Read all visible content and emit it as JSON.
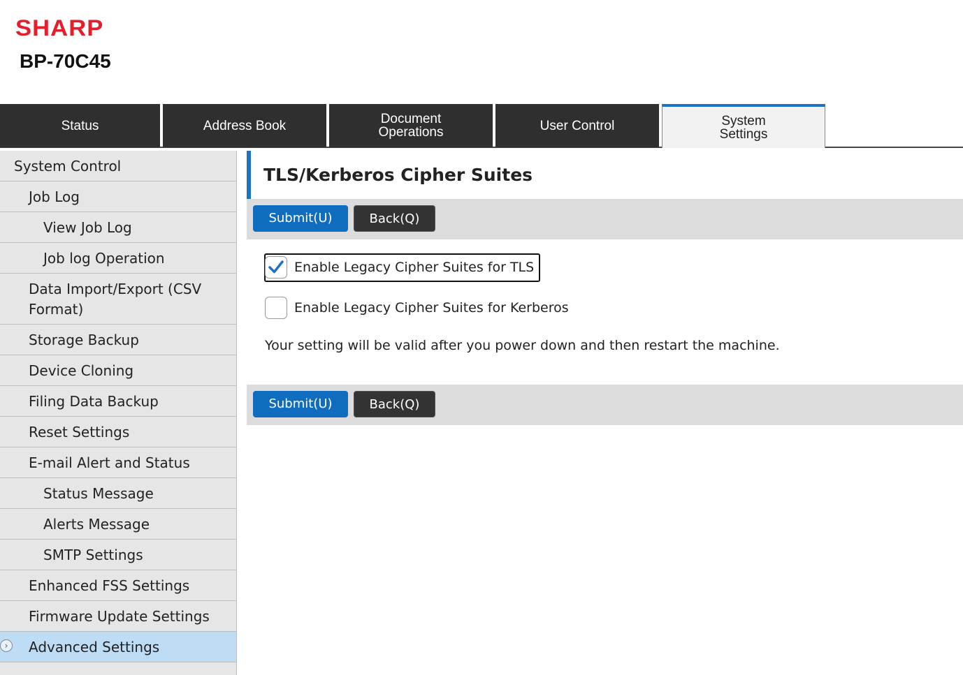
{
  "header": {
    "brand": "SHARP",
    "model": "BP-70C45"
  },
  "tabs": [
    {
      "label": "Status",
      "active": false
    },
    {
      "label": "Address Book",
      "active": false
    },
    {
      "label": "Document\nOperations",
      "active": false
    },
    {
      "label": "User Control",
      "active": false
    },
    {
      "label": "System\nSettings",
      "active": true
    }
  ],
  "sidebar": {
    "items": [
      {
        "label": "System Control",
        "level": 0
      },
      {
        "label": "Job Log",
        "level": 1
      },
      {
        "label": "View Job Log",
        "level": 2
      },
      {
        "label": "Job log Operation",
        "level": 2
      },
      {
        "label": "Data Import/Export (CSV Format)",
        "level": 1
      },
      {
        "label": "Storage Backup",
        "level": 1
      },
      {
        "label": "Device Cloning",
        "level": 1
      },
      {
        "label": "Filing Data Backup",
        "level": 1
      },
      {
        "label": "Reset Settings",
        "level": 1
      },
      {
        "label": "E-mail Alert and Status",
        "level": 1
      },
      {
        "label": "Status Message",
        "level": 2
      },
      {
        "label": "Alerts Message",
        "level": 2
      },
      {
        "label": "SMTP Settings",
        "level": 2
      },
      {
        "label": "Enhanced FSS Settings",
        "level": 1
      },
      {
        "label": "Firmware Update Settings",
        "level": 1
      },
      {
        "label": "Advanced Settings",
        "level": 1,
        "active": true
      }
    ]
  },
  "main": {
    "title": "TLS/Kerberos Cipher Suites",
    "submit_label": "Submit(U)",
    "back_label": "Back(Q)",
    "options": [
      {
        "label": "Enable Legacy Cipher Suites for TLS",
        "checked": true
      },
      {
        "label": "Enable Legacy Cipher Suites for Kerberos",
        "checked": false
      }
    ],
    "note": "Your setting will be valid after you power down and then restart the machine."
  },
  "colors": {
    "brand": "#e41e2b",
    "accent": "#1f73c4",
    "submit": "#0f6cbf",
    "tab_bg": "#2f2f2f",
    "sidebar_active": "#bfdcf5"
  },
  "icons": {
    "sidebar_active": "chevron-right-circle-icon",
    "checkbox_checked": "checkmark-icon"
  }
}
